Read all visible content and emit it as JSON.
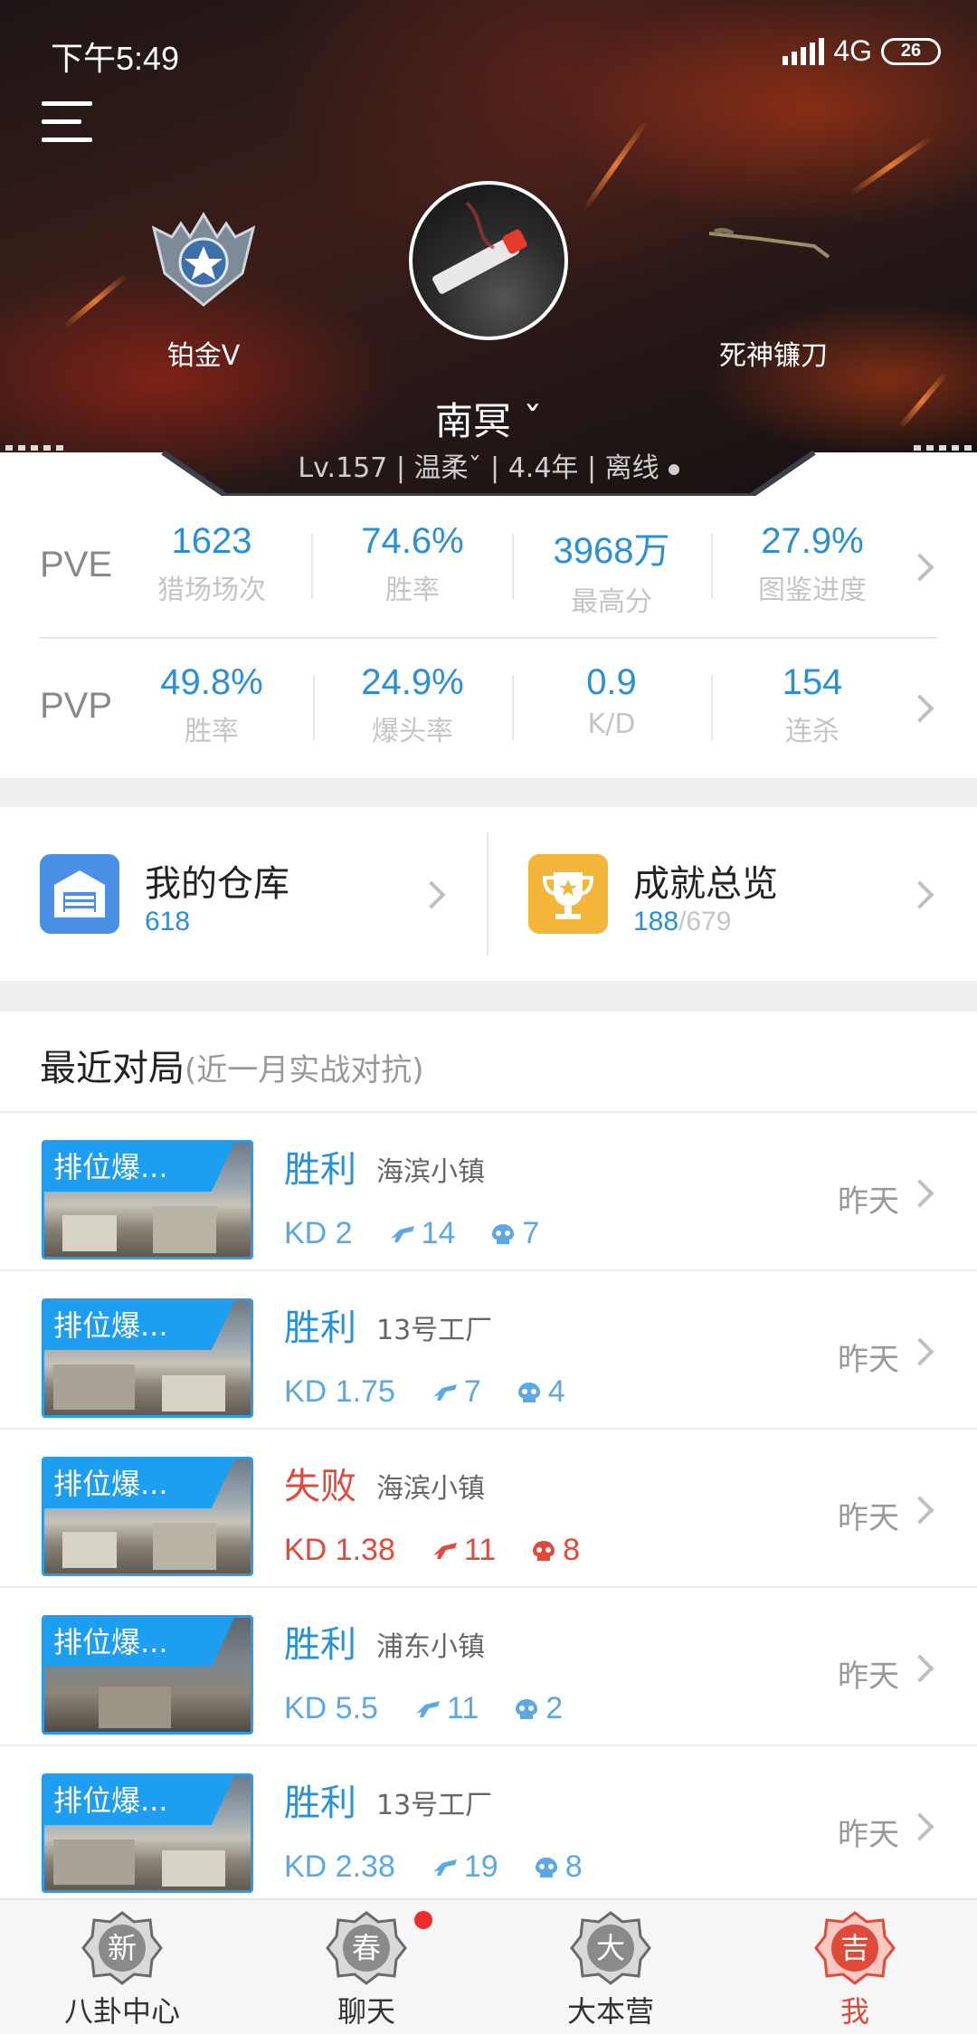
{
  "status_bar": {
    "time": "下午5:49",
    "network": "4G",
    "battery": "26"
  },
  "profile": {
    "rank_label": "铂金V",
    "weapon_label": "死神镰刀",
    "username": "南冥",
    "username_mark": "ˇ",
    "subline": {
      "level": "Lv.157",
      "mood": "温柔",
      "mood_mark": "ˇ",
      "years": "4.4年",
      "status": "离线"
    }
  },
  "stats": {
    "pve": {
      "label": "PVE",
      "items": [
        {
          "value": "1623",
          "label": "猎场场次"
        },
        {
          "value": "74.6%",
          "label": "胜率"
        },
        {
          "value": "3968万",
          "label": "最高分"
        },
        {
          "value": "27.9%",
          "label": "图鉴进度"
        }
      ]
    },
    "pvp": {
      "label": "PVP",
      "items": [
        {
          "value": "49.8%",
          "label": "胜率"
        },
        {
          "value": "24.9%",
          "label": "爆头率"
        },
        {
          "value": "0.9",
          "label": "K/D"
        },
        {
          "value": "154",
          "label": "连杀"
        }
      ]
    }
  },
  "shortcuts": {
    "warehouse": {
      "title": "我的仓库",
      "count": "618"
    },
    "achievements": {
      "title": "成就总览",
      "count": "188",
      "total": "/679"
    }
  },
  "recent": {
    "title": "最近对局",
    "subtitle": "(近一月实战对抗)",
    "matches": [
      {
        "mode": "排位爆...",
        "result": "胜利",
        "map": "海滨小镇",
        "kd": "KD 2",
        "kills": "14",
        "headshots": "7",
        "when": "昨天"
      },
      {
        "mode": "排位爆...",
        "result": "胜利",
        "map": "13号工厂",
        "kd": "KD 1.75",
        "kills": "7",
        "headshots": "4",
        "when": "昨天"
      },
      {
        "mode": "排位爆...",
        "result": "失败",
        "map": "海滨小镇",
        "kd": "KD 1.38",
        "kills": "11",
        "headshots": "8",
        "when": "昨天"
      },
      {
        "mode": "排位爆...",
        "result": "胜利",
        "map": "浦东小镇",
        "kd": "KD 5.5",
        "kills": "11",
        "headshots": "2",
        "when": "昨天"
      },
      {
        "mode": "排位爆...",
        "result": "胜利",
        "map": "13号工厂",
        "kd": "KD 2.38",
        "kills": "19",
        "headshots": "8",
        "when": "昨天"
      }
    ]
  },
  "tabbar": {
    "tabs": [
      {
        "label": "八卦中心",
        "glyph": "新"
      },
      {
        "label": "聊天",
        "glyph": "春"
      },
      {
        "label": "大本营",
        "glyph": "大"
      },
      {
        "label": "我",
        "glyph": "吉"
      }
    ]
  },
  "colors": {
    "accent_blue": "#2b8fd8",
    "loss_red": "#e04a3a",
    "badge_red": "#ef2b2b"
  }
}
